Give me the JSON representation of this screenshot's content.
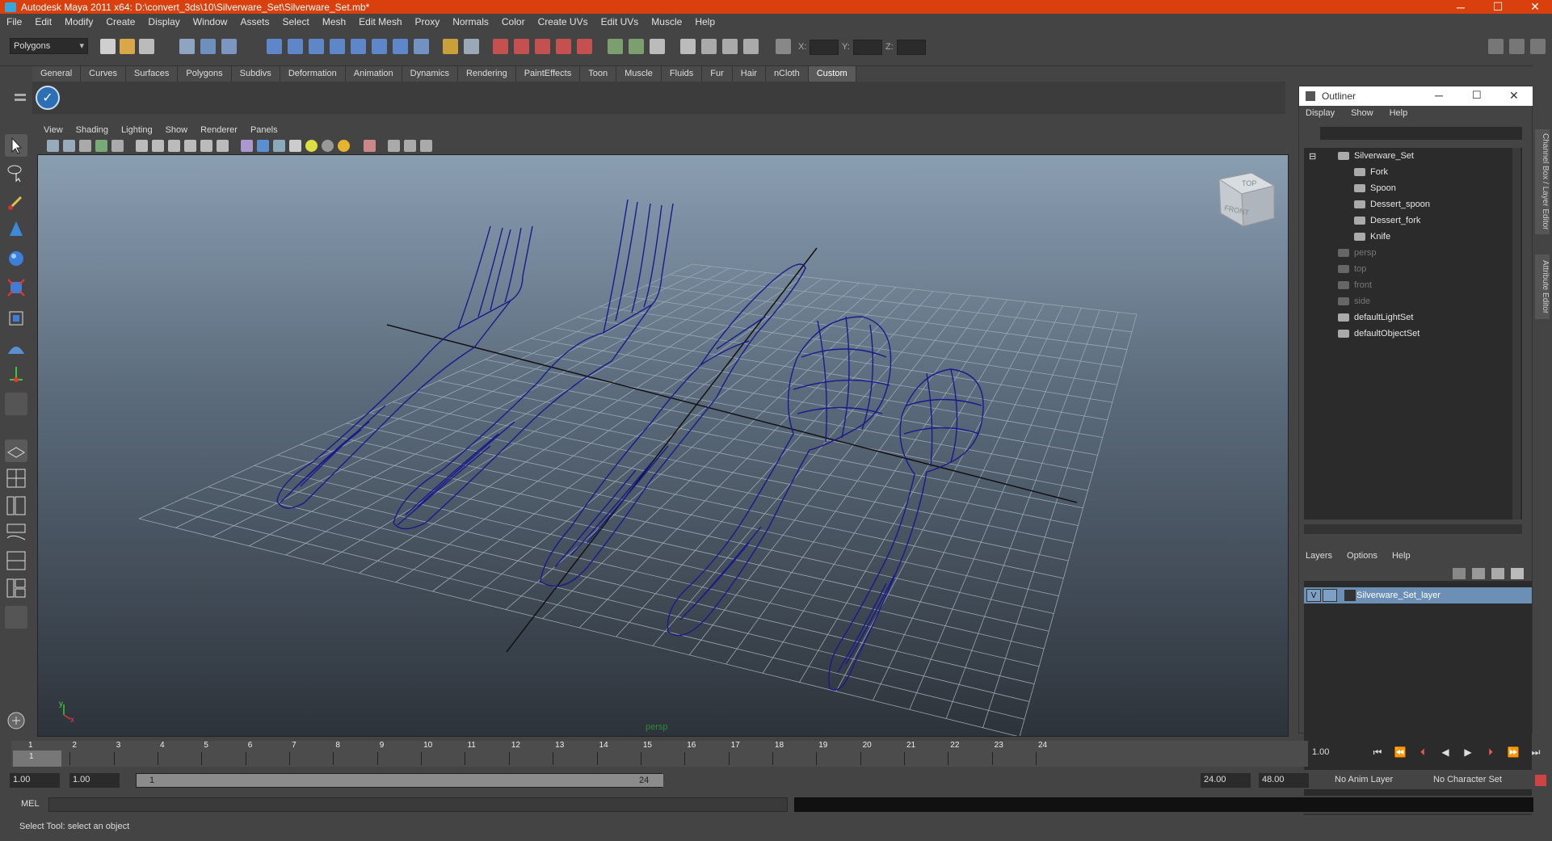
{
  "window": {
    "title": "Autodesk Maya 2011 x64: D:\\convert_3ds\\10\\Silverware_Set\\Silverware_Set.mb*"
  },
  "menubar": [
    "File",
    "Edit",
    "Modify",
    "Create",
    "Display",
    "Window",
    "Assets",
    "Select",
    "Mesh",
    "Edit Mesh",
    "Proxy",
    "Normals",
    "Color",
    "Create UVs",
    "Edit UVs",
    "Muscle",
    "Help"
  ],
  "toolbar": {
    "mode": "Polygons",
    "x_label": "X:",
    "y_label": "Y:",
    "z_label": "Z:"
  },
  "shelf_tabs": [
    "General",
    "Curves",
    "Surfaces",
    "Polygons",
    "Subdivs",
    "Deformation",
    "Animation",
    "Dynamics",
    "Rendering",
    "PaintEffects",
    "Toon",
    "Muscle",
    "Fluids",
    "Fur",
    "Hair",
    "nCloth",
    "Custom"
  ],
  "shelf_active": "Custom",
  "viewport": {
    "menu": [
      "View",
      "Shading",
      "Lighting",
      "Show",
      "Renderer",
      "Panels"
    ],
    "camera_label": "persp",
    "cube_top": "TOP",
    "cube_front": "FRONT",
    "axis_y": "y",
    "axis_x": "x",
    "wire_color": "#1a1a8c"
  },
  "outliner": {
    "title": "Outliner",
    "menu": [
      "Display",
      "Show",
      "Help"
    ],
    "items": [
      {
        "label": "Silverware_Set",
        "indent": 0,
        "dim": false
      },
      {
        "label": "Fork",
        "indent": 1,
        "dim": false
      },
      {
        "label": "Spoon",
        "indent": 1,
        "dim": false
      },
      {
        "label": "Dessert_spoon",
        "indent": 1,
        "dim": false
      },
      {
        "label": "Dessert_fork",
        "indent": 1,
        "dim": false
      },
      {
        "label": "Knife",
        "indent": 1,
        "dim": false
      },
      {
        "label": "persp",
        "indent": 0,
        "dim": true
      },
      {
        "label": "top",
        "indent": 0,
        "dim": true
      },
      {
        "label": "front",
        "indent": 0,
        "dim": true
      },
      {
        "label": "side",
        "indent": 0,
        "dim": true
      },
      {
        "label": "defaultLightSet",
        "indent": 0,
        "dim": false
      },
      {
        "label": "defaultObjectSet",
        "indent": 0,
        "dim": false
      }
    ]
  },
  "layers": {
    "menu": [
      "Layers",
      "Options",
      "Help"
    ],
    "row": {
      "visible": "V",
      "name": "Silverware_Set_layer"
    }
  },
  "side_tabs": {
    "channel_box": "Channel Box / Layer Editor",
    "attribute_editor": "Attribute Editor"
  },
  "timeline": {
    "frames": [
      "1",
      "2",
      "3",
      "4",
      "5",
      "6",
      "7",
      "8",
      "9",
      "10",
      "11",
      "12",
      "13",
      "14",
      "15",
      "16",
      "17",
      "18",
      "19",
      "20",
      "21",
      "22",
      "23",
      "24"
    ],
    "current": "1",
    "current_time": "1.00"
  },
  "range": {
    "start": "1.00",
    "start2": "1.00",
    "slider_start": "1",
    "slider_end": "24",
    "end": "24.00",
    "end2": "48.00",
    "anim_layer": "No Anim Layer",
    "char_set": "No Character Set"
  },
  "mel": {
    "label": "MEL"
  },
  "help_line": "Select Tool: select an object"
}
